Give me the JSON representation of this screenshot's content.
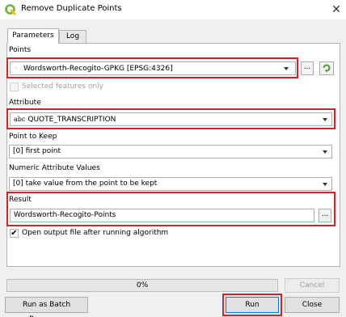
{
  "window": {
    "title": "Remove Duplicate Points",
    "close_glyph": "✕"
  },
  "tabs": [
    {
      "label": "Parameters",
      "active": true
    },
    {
      "label": "Log",
      "active": false
    }
  ],
  "params": {
    "points_label": "Points",
    "points_value": "Wordsworth-Recogito-GPKG [EPSG:4326]",
    "points_more": "...",
    "selected_only_label": "Selected features only",
    "selected_only_checked": false,
    "attribute_label": "Attribute",
    "attribute_type_icon": "abc",
    "attribute_value": "QUOTE_TRANSCRIPTION",
    "point_to_keep_label": "Point to Keep",
    "point_to_keep_value": "[0] first point",
    "numeric_label": "Numeric Attribute Values",
    "numeric_value": "[0] take value from the point to be kept",
    "result_label": "Result",
    "result_value": "Wordsworth-Recogito-Points",
    "result_more": "...",
    "open_output_label": "Open output file after running algorithm",
    "open_output_checked": true
  },
  "progress": {
    "value": 0,
    "text": "0%"
  },
  "buttons": {
    "cancel": "Cancel",
    "batch": "Run as Batch Process...",
    "run": "Run",
    "close": "Close"
  },
  "colors": {
    "highlight": "#d2222a",
    "qgis_green": "#6eb33f",
    "qgis_yellow": "#f0c02a"
  }
}
